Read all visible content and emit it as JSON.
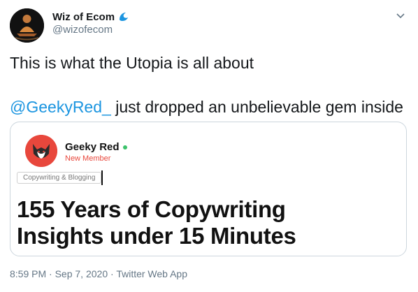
{
  "author": {
    "name": "Wiz of Ecom",
    "handle": "@wizofecom"
  },
  "tweet": {
    "line1": "This is what the Utopia is all about",
    "mention": "@GeekyRed_",
    "line2_rest": " just dropped an unbelievable gem inside"
  },
  "card": {
    "name": "Geeky Red",
    "role": "New Member",
    "tag": "Copywriting & Blogging",
    "title_line1": "155 Years of Copywriting",
    "title_line2": "Insights under 15 Minutes"
  },
  "meta": {
    "time": "8:59 PM",
    "sep1": " · ",
    "date": "Sep 7, 2020",
    "sep2": " · ",
    "source": "Twitter Web App"
  },
  "colors": {
    "link": "#1b95e0",
    "secondary_text": "#657786",
    "card_accent": "#e8473c",
    "online": "#3cc26b"
  },
  "icons": {
    "verified_like": "wave-icon",
    "menu": "chevron-down-icon"
  }
}
